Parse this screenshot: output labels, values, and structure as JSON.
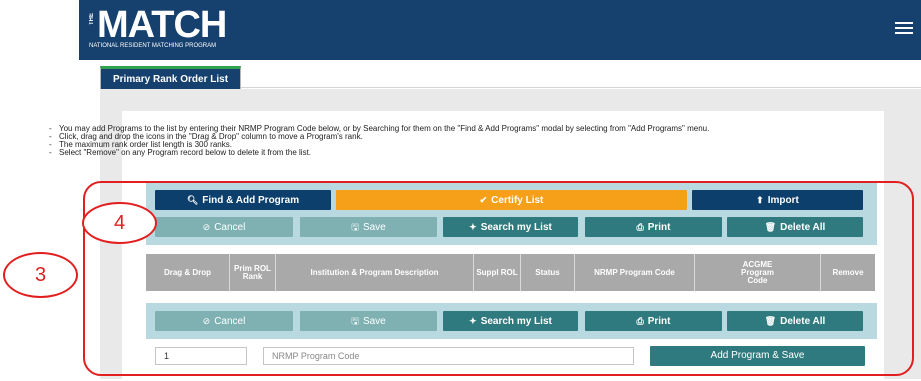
{
  "header": {
    "logo_the": "THE",
    "logo_match": "MATCH",
    "logo_subtitle": "NATIONAL RESIDENT MATCHING PROGRAM",
    "menu_icon": "hamburger-menu-icon",
    "colors": {
      "navy": "#16406e",
      "tab_accent": "#31a24c"
    }
  },
  "tabs": [
    {
      "label": "Primary Rank Order List"
    }
  ],
  "instructions": [
    "You may add Programs to the list by entering their NRMP Program Code below, or by Searching for them on the \"Find & Add Programs\" modal by selecting from \"Add Programs\" menu.",
    "Click, drag and drop the icons in the \"Drag & Drop\" column to move a Program's rank.",
    "The maximum rank order list length is 300 ranks.",
    "Select \"Remove\" on any Program record below to delete it from the list."
  ],
  "top_actions": {
    "find_add": {
      "label": "Find & Add Program",
      "icon": "magnifier-plus-icon"
    },
    "certify": {
      "label": "Certify List",
      "icon": "checkmark-icon"
    },
    "import": {
      "label": "Import",
      "icon": "upload-icon"
    }
  },
  "toolbar": {
    "cancel": {
      "label": "Cancel",
      "icon": "cancel-circle-icon"
    },
    "save": {
      "label": "Save",
      "icon": "floppy-disk-icon"
    },
    "search": {
      "label": "Search my List",
      "icon": "binoculars-icon"
    },
    "print": {
      "label": "Print",
      "icon": "printer-icon"
    },
    "delete_all": {
      "label": "Delete All",
      "icon": "trash-icon"
    }
  },
  "table": {
    "columns": [
      "Drag & Drop",
      "Prim ROL Rank",
      "Institution & Program Description",
      "Suppl ROL",
      "Status",
      "NRMP Program Code",
      "ACGME Program Code",
      "Remove"
    ]
  },
  "add_row": {
    "rank_value": "1",
    "code_placeholder": "NRMP Program Code",
    "add_button": "Add Program & Save"
  },
  "annotations": {
    "circle_3": "3",
    "circle_4": "4",
    "color": "#e21f1f"
  }
}
